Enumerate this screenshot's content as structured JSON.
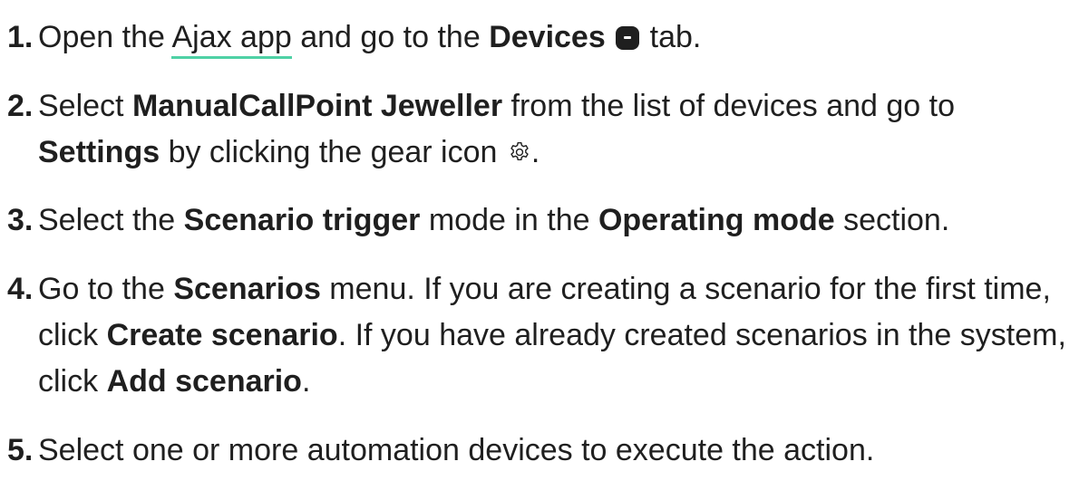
{
  "steps": [
    {
      "number": "1.",
      "t1": "Open the ",
      "link": "Ajax app",
      "t2": " and go to the ",
      "b1": "Devices",
      "icon": "devices-tab-icon",
      "t3": " tab."
    },
    {
      "number": "2.",
      "t1": "Select ",
      "b1": "ManualCallPoint Jeweller",
      "t2": " from the list of devices and go to ",
      "b2": "Settings",
      "t3": " by clicking the gear icon ",
      "icon": "gear-icon",
      "t4": "."
    },
    {
      "number": "3.",
      "t1": "Select the ",
      "b1": "Scenario trigger",
      "t2": " mode in the ",
      "b2": "Operating mode",
      "t3": " section."
    },
    {
      "number": "4.",
      "t1": "Go to the ",
      "b1": "Scenarios",
      "t2": " menu. If you are creating a scenario for the first time, click ",
      "b2": "Create scenario",
      "t3": ". If you have already created scenarios in the system, click ",
      "b3": "Add scenario",
      "t4": "."
    },
    {
      "number": "5.",
      "t1": "Select one or more automation devices to execute the action."
    }
  ],
  "colors": {
    "text": "#1f1f1f",
    "link_underline": "#4fd1a5",
    "background": "#ffffff"
  }
}
